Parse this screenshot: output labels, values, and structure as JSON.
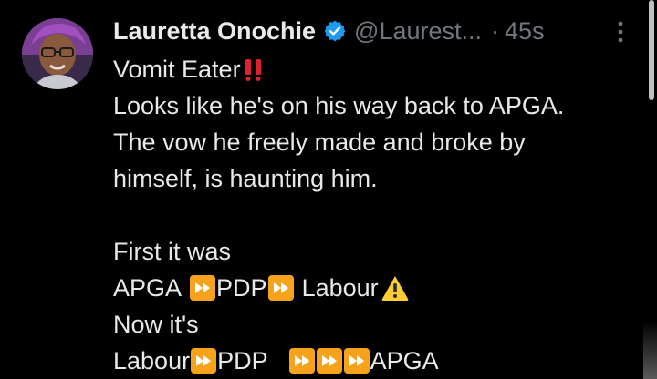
{
  "author": {
    "display_name": "Lauretta Onochie",
    "handle": "@Laurest...",
    "separator": "·",
    "time": "45s",
    "verified": true
  },
  "icons": {
    "verified": "verified-badge-icon",
    "more": "more-vertical-icon",
    "fast_forward": "fast-forward-emoji",
    "double_exclamation": "double-exclamation-emoji",
    "warning": "warning-emoji"
  },
  "colors": {
    "background": "#000000",
    "text": "#e7e9ea",
    "secondary": "#71767b",
    "verified": "#1d9bf0",
    "emoji_orange": "#f7a21b",
    "emoji_red": "#e0202e",
    "warning_yellow": "#ffcc32"
  },
  "tweet": {
    "line1": "Vomit Eater",
    "line2": "Looks like he's on his way back to APGA.",
    "line3": "The vow he freely made and broke by",
    "line4": "himself, is haunting him.",
    "line5": "First it was",
    "line6": {
      "a": "APGA",
      "b": "PDP",
      "c": "Labour"
    },
    "line7": "Now it's",
    "line8": {
      "a": "Labour",
      "b": "PDP",
      "c": "APGA"
    }
  }
}
